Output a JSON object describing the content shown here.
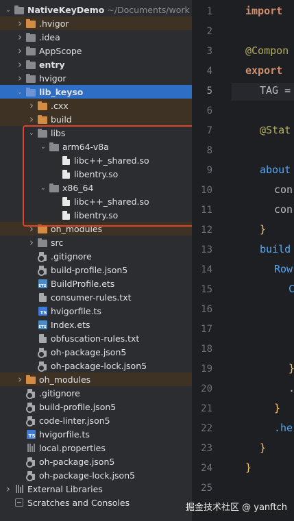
{
  "project_tree": [
    {
      "label": "NativeKeyDemo",
      "path": "~/Documents/work",
      "depth": 0,
      "arrow": "open",
      "icon": "folder",
      "bold": true
    },
    {
      "label": ".hvigor",
      "depth": 1,
      "arrow": "closed",
      "icon": "folder-orange",
      "excluded": true
    },
    {
      "label": ".idea",
      "depth": 1,
      "arrow": "closed",
      "icon": "folder"
    },
    {
      "label": "AppScope",
      "depth": 1,
      "arrow": "closed",
      "icon": "folder"
    },
    {
      "label": "entry",
      "depth": 1,
      "arrow": "closed",
      "icon": "folder",
      "bold": true
    },
    {
      "label": "hvigor",
      "depth": 1,
      "arrow": "closed",
      "icon": "folder"
    },
    {
      "label": "lib_keyso",
      "depth": 1,
      "arrow": "open",
      "icon": "folder-blue",
      "bold": true,
      "selected": true
    },
    {
      "label": ".cxx",
      "depth": 2,
      "arrow": "closed",
      "icon": "folder-orange",
      "excluded": true
    },
    {
      "label": "build",
      "depth": 2,
      "arrow": "closed",
      "icon": "folder-orange",
      "excluded": true
    },
    {
      "label": "libs",
      "depth": 2,
      "arrow": "open",
      "icon": "folder"
    },
    {
      "label": "arm64-v8a",
      "depth": 3,
      "arrow": "open",
      "icon": "folder"
    },
    {
      "label": "libc++_shared.so",
      "depth": 4,
      "arrow": "none",
      "icon": "file"
    },
    {
      "label": "libentry.so",
      "depth": 4,
      "arrow": "none",
      "icon": "file"
    },
    {
      "label": "x86_64",
      "depth": 3,
      "arrow": "open",
      "icon": "folder"
    },
    {
      "label": "libc++_shared.so",
      "depth": 4,
      "arrow": "none",
      "icon": "file"
    },
    {
      "label": "libentry.so",
      "depth": 4,
      "arrow": "none",
      "icon": "file"
    },
    {
      "label": "oh_modules",
      "depth": 2,
      "arrow": "closed",
      "icon": "folder-orange",
      "excluded": true
    },
    {
      "label": "src",
      "depth": 2,
      "arrow": "closed",
      "icon": "folder"
    },
    {
      "label": ".gitignore",
      "depth": 2,
      "arrow": "none",
      "icon": "config"
    },
    {
      "label": "build-profile.json5",
      "depth": 2,
      "arrow": "none",
      "icon": "config"
    },
    {
      "label": "BuildProfile.ets",
      "depth": 2,
      "arrow": "none",
      "icon": "ets"
    },
    {
      "label": "consumer-rules.txt",
      "depth": 2,
      "arrow": "none",
      "icon": "text"
    },
    {
      "label": "hvigorfile.ts",
      "depth": 2,
      "arrow": "none",
      "icon": "ts"
    },
    {
      "label": "Index.ets",
      "depth": 2,
      "arrow": "none",
      "icon": "ets"
    },
    {
      "label": "obfuscation-rules.txt",
      "depth": 2,
      "arrow": "none",
      "icon": "text"
    },
    {
      "label": "oh-package.json5",
      "depth": 2,
      "arrow": "none",
      "icon": "config"
    },
    {
      "label": "oh-package-lock.json5",
      "depth": 2,
      "arrow": "none",
      "icon": "config"
    },
    {
      "label": "oh_modules",
      "depth": 1,
      "arrow": "closed",
      "icon": "folder-orange",
      "excluded": true
    },
    {
      "label": ".gitignore",
      "depth": 1,
      "arrow": "none",
      "icon": "config"
    },
    {
      "label": "build-profile.json5",
      "depth": 1,
      "arrow": "none",
      "icon": "config"
    },
    {
      "label": "code-linter.json5",
      "depth": 1,
      "arrow": "none",
      "icon": "config"
    },
    {
      "label": "hvigorfile.ts",
      "depth": 1,
      "arrow": "none",
      "icon": "ts"
    },
    {
      "label": "local.properties",
      "depth": 1,
      "arrow": "none",
      "icon": "bars"
    },
    {
      "label": "oh-package.json5",
      "depth": 1,
      "arrow": "none",
      "icon": "config"
    },
    {
      "label": "oh-package-lock.json5",
      "depth": 1,
      "arrow": "none",
      "icon": "config"
    },
    {
      "label": "External Libraries",
      "depth": 0,
      "arrow": "closed",
      "icon": "bars"
    },
    {
      "label": "Scratches and Consoles",
      "depth": 0,
      "arrow": "none",
      "icon": "scratch"
    }
  ],
  "line_numbers": [
    "1",
    "2",
    "3",
    "4",
    "5",
    "6",
    "7",
    "8",
    "9",
    "10",
    "11",
    "12",
    "13",
    "14",
    "15",
    "16",
    "17",
    "18",
    "19",
    "20",
    "21",
    "22",
    "23",
    "24",
    "25"
  ],
  "current_line": "5",
  "code_lines": [
    {
      "line": "1",
      "indent": 0,
      "tokens": [
        {
          "t": "import",
          "c": "kw"
        }
      ]
    },
    {
      "line": "3",
      "indent": 0,
      "tokens": [
        {
          "t": "@Compon",
          "c": "ann"
        }
      ]
    },
    {
      "line": "4",
      "indent": 0,
      "tokens": [
        {
          "t": "export",
          "c": "kw"
        }
      ]
    },
    {
      "line": "5",
      "indent": 1,
      "tokens": [
        {
          "t": "TAG =",
          "c": "pl"
        }
      ]
    },
    {
      "line": "7",
      "indent": 1,
      "tokens": [
        {
          "t": "@Stat",
          "c": "ann"
        }
      ]
    },
    {
      "line": "9",
      "indent": 1,
      "tokens": [
        {
          "t": "about",
          "c": "fn"
        }
      ]
    },
    {
      "line": "10",
      "indent": 2,
      "tokens": [
        {
          "t": "con",
          "c": "pl"
        }
      ]
    },
    {
      "line": "11",
      "indent": 2,
      "tokens": [
        {
          "t": "con",
          "c": "pl"
        }
      ]
    },
    {
      "line": "12",
      "indent": 1,
      "tokens": [
        {
          "t": "}",
          "c": "brace"
        }
      ]
    },
    {
      "line": "13",
      "indent": 1,
      "tokens": [
        {
          "t": "build",
          "c": "fn"
        }
      ]
    },
    {
      "line": "14",
      "indent": 2,
      "tokens": [
        {
          "t": "Row",
          "c": "fn"
        }
      ]
    },
    {
      "line": "15",
      "indent": 3,
      "tokens": [
        {
          "t": "C",
          "c": "fn"
        }
      ]
    },
    {
      "line": "19",
      "indent": 3,
      "tokens": [
        {
          "t": "}",
          "c": "brace"
        }
      ]
    },
    {
      "line": "20",
      "indent": 3,
      "tokens": [
        {
          "t": ".",
          "c": "pl"
        }
      ]
    },
    {
      "line": "21",
      "indent": 2,
      "tokens": [
        {
          "t": "}",
          "c": "brace"
        }
      ]
    },
    {
      "line": "22",
      "indent": 2,
      "tokens": [
        {
          "t": ".he",
          "c": "fn"
        }
      ]
    },
    {
      "line": "23",
      "indent": 1,
      "tokens": [
        {
          "t": "}",
          "c": "brace"
        }
      ]
    },
    {
      "line": "24",
      "indent": 0,
      "tokens": [
        {
          "t": "}",
          "c": "brace"
        }
      ]
    }
  ],
  "watermark": "掘金技术社区 @ yanftch",
  "colors": {
    "selection": "#2e6ec4",
    "highlight_box": "#e3432a",
    "excluded_bg": "#3d3223"
  }
}
